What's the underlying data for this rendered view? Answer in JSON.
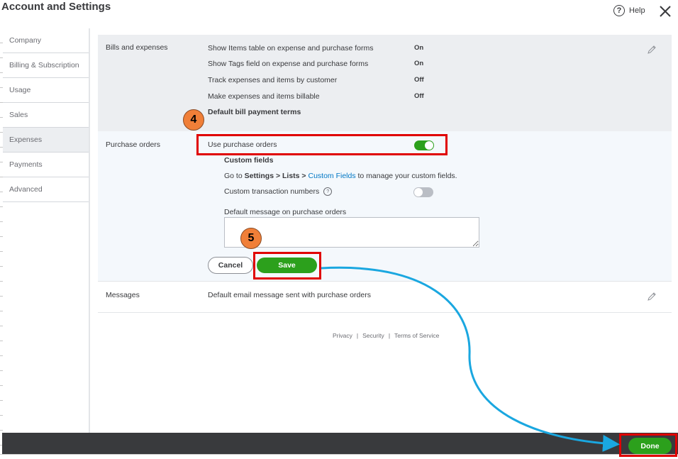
{
  "header": {
    "title": "Account and Settings",
    "help_label": "Help",
    "help_glyph": "?"
  },
  "sidebar": {
    "items": [
      {
        "label": "Company"
      },
      {
        "label": "Billing & Subscription"
      },
      {
        "label": "Usage"
      },
      {
        "label": "Sales"
      },
      {
        "label": "Expenses",
        "active": true
      },
      {
        "label": "Payments"
      },
      {
        "label": "Advanced"
      }
    ]
  },
  "bills_section": {
    "heading": "Bills and expenses",
    "rows": [
      {
        "label": "Show Items table on expense and purchase forms",
        "value": "On"
      },
      {
        "label": "Show Tags field on expense and purchase forms",
        "value": "On"
      },
      {
        "label": "Track expenses and items by customer",
        "value": "Off"
      },
      {
        "label": "Make expenses and items billable",
        "value": "Off"
      }
    ],
    "payment_terms_label": "Default bill payment terms"
  },
  "purchase_orders": {
    "heading": "Purchase orders",
    "use_po_label": "Use purchase orders",
    "use_po_enabled": true,
    "custom_fields_heading": "Custom fields",
    "custom_fields_note": {
      "prefix": "Go to ",
      "settings": "Settings",
      "arrow1": " > ",
      "lists": "Lists",
      "arrow2": " > ",
      "link": "Custom Fields",
      "suffix": " to manage your custom fields."
    },
    "custom_txn_label": "Custom transaction numbers",
    "custom_txn_enabled": false,
    "default_message_label": "Default message on purchase orders",
    "default_message_value": "",
    "cancel_label": "Cancel",
    "save_label": "Save"
  },
  "messages_section": {
    "heading": "Messages",
    "description": "Default email message sent with purchase orders"
  },
  "footer": {
    "privacy": "Privacy",
    "security": "Security",
    "terms": "Terms of Service",
    "separator": "|"
  },
  "bottom_bar": {
    "done_label": "Done"
  },
  "annotations": {
    "step4": "4",
    "step5": "5"
  },
  "colors": {
    "accent_green": "#2ca01c",
    "highlight_red": "#e00000",
    "step_badge": "#f07f38",
    "arrow_blue": "#1aa7e0",
    "link_blue": "#0077c5"
  }
}
